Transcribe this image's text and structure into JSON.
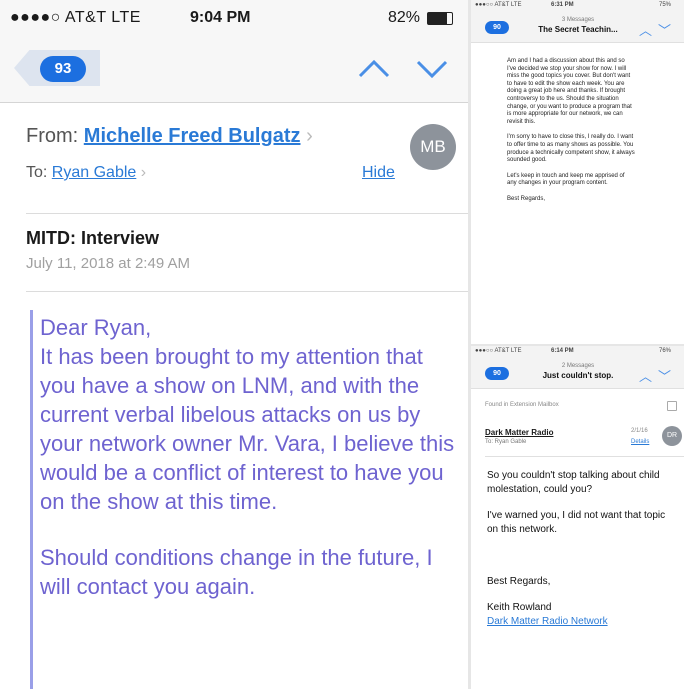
{
  "main": {
    "status": {
      "carrier": "●●●●○ AT&T  LTE",
      "time": "9:04 PM",
      "battery": "82%"
    },
    "nav": {
      "unread_count": "93"
    },
    "header": {
      "from_label": "From:",
      "from_name": "Michelle Freed Bulgatz",
      "to_label": "To:",
      "to_name": "Ryan Gable",
      "hide_label": "Hide",
      "avatar_initials": "MB"
    },
    "subject": "MITD: Interview",
    "date": "July 11, 2018 at 2:49 AM",
    "body": {
      "greeting": "Dear Ryan,",
      "paragraph1": "It has been brought to my attention that you have a show on LNM, and with the current verbal libelous attacks on us by your network owner Mr. Vara, I believe this would be a conflict of interest to have you on the show at this time.",
      "paragraph2": "Should conditions change in the future, I will contact you again."
    }
  },
  "top_right": {
    "status": {
      "carrier": "●●●○○ AT&T  LTE",
      "time": "6:31 PM",
      "battery": "75%"
    },
    "nav": {
      "unread_count": "90",
      "title_sub": "3 Messages",
      "title_main": "The Secret Teachin..."
    },
    "body": {
      "p1": "Am and I had a discussion about this and so I've decided we stop your show for now. I will miss the good topics you cover. But don't want to have to edit the show each week. You are doing a great job here and thanks. If brought controversy to the us. Should the situation change, or you want to produce a program that is more appropriate for our network, we can revisit this.",
      "p2": "I'm sorry to have to close this, I really do. I want to offer time to as many shows as possible. You produce a technically competent show, it always sounded good.",
      "p3": "Let's keep in touch and keep me apprised of any changes in your program content.",
      "closing": "Best Regards,"
    }
  },
  "bottom_right": {
    "status": {
      "carrier": "●●●○○ AT&T  LTE",
      "time": "6:14 PM",
      "battery": "76%"
    },
    "nav": {
      "unread_count": "90",
      "title_sub": "2 Messages",
      "title_main": "Just couldn't stop."
    },
    "folder": "Found in Extension Mailbox",
    "from_name": "Dark Matter Radio",
    "to_line": "To: Ryan Gable",
    "date": "2/1/16",
    "details_label": "Details",
    "avatar_initials": "DR",
    "body": {
      "p1": "So you couldn't stop talking about child molestation, could you?",
      "p2": "I've warned you, I did not want that topic on this network.",
      "closing": "Best Regards,",
      "signature": "Keith Rowland",
      "signature_link": "Dark Matter Radio Network"
    }
  },
  "colors": {
    "accent": "#1c6fe0",
    "link": "#2a7ad6",
    "quote_text": "#6e63d0",
    "quote_bar": "#9a9fe8"
  }
}
